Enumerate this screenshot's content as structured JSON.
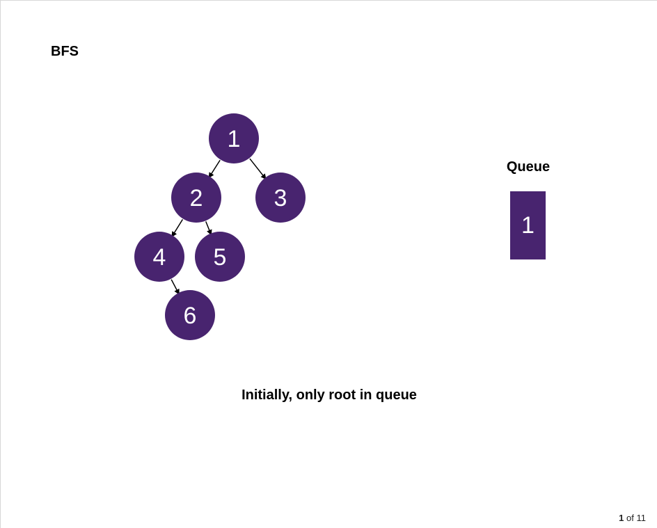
{
  "slide": {
    "title": "BFS",
    "caption": "Initially, only root in queue"
  },
  "tree": {
    "node_color": "#48246f",
    "nodes": [
      {
        "id": "1",
        "label": "1"
      },
      {
        "id": "2",
        "label": "2"
      },
      {
        "id": "3",
        "label": "3"
      },
      {
        "id": "4",
        "label": "4"
      },
      {
        "id": "5",
        "label": "5"
      },
      {
        "id": "6",
        "label": "6"
      }
    ],
    "edges": [
      {
        "from": "1",
        "to": "2"
      },
      {
        "from": "1",
        "to": "3"
      },
      {
        "from": "2",
        "to": "4"
      },
      {
        "from": "2",
        "to": "5"
      },
      {
        "from": "4",
        "to": "6"
      }
    ]
  },
  "queue": {
    "title": "Queue",
    "items": [
      "1"
    ]
  },
  "pager": {
    "current": "1",
    "of_word": "of",
    "total": "11"
  }
}
